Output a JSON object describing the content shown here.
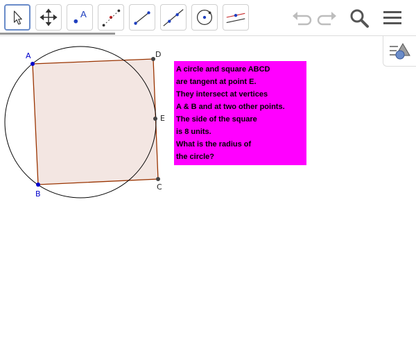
{
  "toolbar": {
    "tools": [
      {
        "name": "move-tool",
        "selected": true
      },
      {
        "name": "move-graphics-view-tool",
        "selected": false
      },
      {
        "name": "point-tool",
        "selected": false,
        "label": "A"
      },
      {
        "name": "two-points-tool",
        "selected": false
      },
      {
        "name": "segment-tool",
        "selected": false
      },
      {
        "name": "line-tool",
        "selected": false
      },
      {
        "name": "circle-center-point-tool",
        "selected": false
      },
      {
        "name": "perpendicular-line-tool",
        "selected": false
      }
    ],
    "actions": [
      "undo",
      "redo",
      "search",
      "menu"
    ]
  },
  "colors": {
    "accent": "#6a8cc9",
    "point_blue": "#0000cc",
    "point_dark": "#444444",
    "square_stroke": "#993300",
    "square_fill": "#f3e6e2",
    "textbox_bg": "#ff00ff"
  },
  "canvas": {
    "points": {
      "A": "A",
      "B": "B",
      "C": "C",
      "D": "D",
      "E": "E"
    },
    "textbox": {
      "lines": [
        "A circle and square ABCD",
        "are tangent at point E.",
        "They intersect at vertices",
        "A & B and at two other points.",
        "The side of the square",
        "is 8 units.",
        "What is the radius of",
        "the circle?"
      ]
    }
  }
}
